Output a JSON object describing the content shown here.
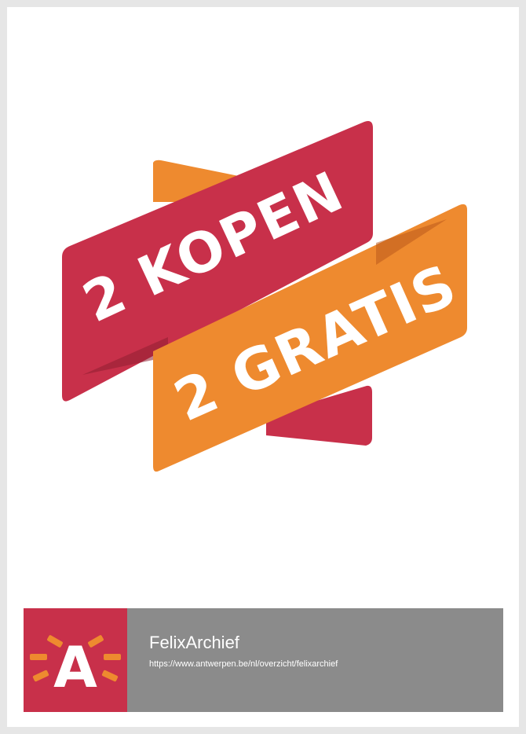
{
  "promo": {
    "line1": "2 KOPEN",
    "line2": "2 GRATIS",
    "colors": {
      "red": "#c8304a",
      "orange": "#ee8a2f",
      "shadow": "#8f1f32"
    }
  },
  "footer": {
    "logo_letter": "A",
    "logo_icon": "antwerpen-logo-icon",
    "org_name": "FelixArchief",
    "url": "https://www.antwerpen.be/nl/overzicht/felixarchief",
    "colors": {
      "logo_bg": "#c8304a",
      "info_bg": "#8b8b8b",
      "rays": "#ee8a2f"
    }
  }
}
